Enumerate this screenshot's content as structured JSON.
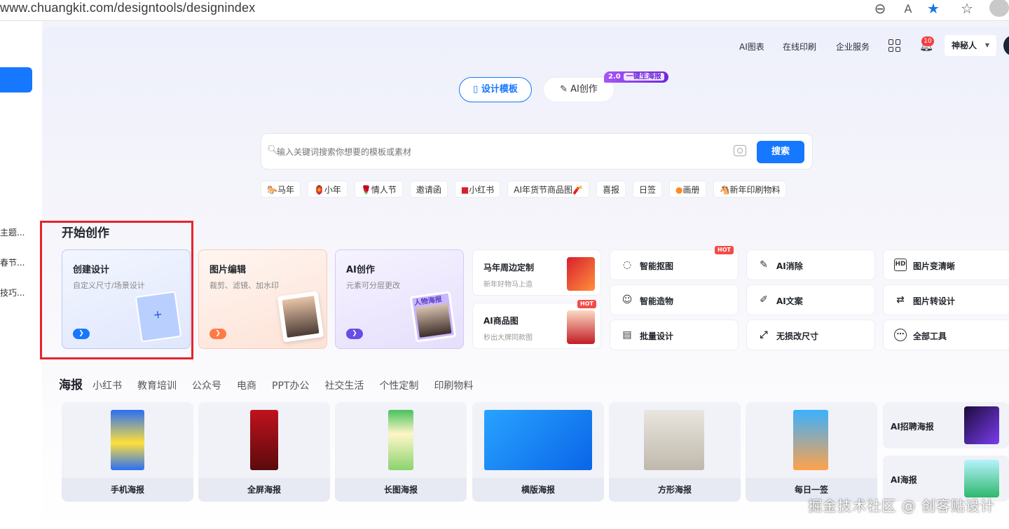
{
  "browser": {
    "url": "www.chuangkit.com/designtools/designindex"
  },
  "sidebar": {
    "items": [
      "主题...",
      "春节...",
      "技巧..."
    ]
  },
  "topnav": {
    "items": [
      "AI图表",
      "在线印刷",
      "企业服务"
    ],
    "notification_count": "10",
    "user_name": "神秘人"
  },
  "mode_tabs": {
    "design": "设计模板",
    "ai": "AI创作",
    "badge_version": "2.0",
    "badge_text": "一键生海报"
  },
  "search": {
    "placeholder": "输入关键词搜索你想要的模板或素材",
    "button": "搜索"
  },
  "tags": [
    {
      "icon": "🐎",
      "label": "马年"
    },
    {
      "icon": "🏮",
      "label": "小年"
    },
    {
      "icon": "🌹",
      "label": "情人节"
    },
    {
      "icon": "",
      "label": "邀请函"
    },
    {
      "icon": "■",
      "label": "小红书"
    },
    {
      "icon": "",
      "label": "AI年货节商品图🧨"
    },
    {
      "icon": "",
      "label": "喜报"
    },
    {
      "icon": "",
      "label": "日签"
    },
    {
      "icon": "●",
      "label": "画册"
    },
    {
      "icon": "🐴",
      "label": "新年印刷物料"
    }
  ],
  "create": {
    "title": "开始创作",
    "cards": [
      {
        "title": "创建设计",
        "subtitle": "自定义尺寸/场景设计",
        "color": "#1677ff"
      },
      {
        "title": "图片编辑",
        "subtitle": "裁剪、滤镜、加水印",
        "color": "#ff7a45"
      },
      {
        "title": "AI创作",
        "subtitle": "元素可分层更改",
        "color": "#6b4ce6",
        "label": "人物海报"
      }
    ],
    "features": [
      {
        "title": "马年周边定制",
        "subtitle": "新年好物马上造"
      },
      {
        "title": "AI商品图",
        "subtitle": "秒出大牌同款图",
        "hot": "HOT"
      }
    ],
    "tools": [
      {
        "label": "智能抠图",
        "icon": "◌",
        "hot": "HOT"
      },
      {
        "label": "AI消除",
        "icon": "✎"
      },
      {
        "label": "图片变清晰",
        "icon": "HD"
      },
      {
        "label": "智能造物",
        "icon": "☺"
      },
      {
        "label": "AI文案",
        "icon": "✐"
      },
      {
        "label": "图片转设计",
        "icon": "⇄"
      },
      {
        "label": "批量设计",
        "icon": "▤"
      },
      {
        "label": "无损改尺寸",
        "icon": "⤢"
      },
      {
        "label": "全部工具",
        "icon": "⋯"
      }
    ]
  },
  "categories": [
    "海报",
    "小红书",
    "教育培训",
    "公众号",
    "电商",
    "PPT办公",
    "社交生活",
    "个性定制",
    "印刷物料"
  ],
  "templates": [
    "手机海报",
    "全屏海报",
    "长图海报",
    "横版海报",
    "方形海报",
    "每日一签"
  ],
  "ai_templates": [
    "AI招聘海报",
    "AI海报"
  ],
  "watermark": "掘金技术社区 @ 创客贴设计"
}
